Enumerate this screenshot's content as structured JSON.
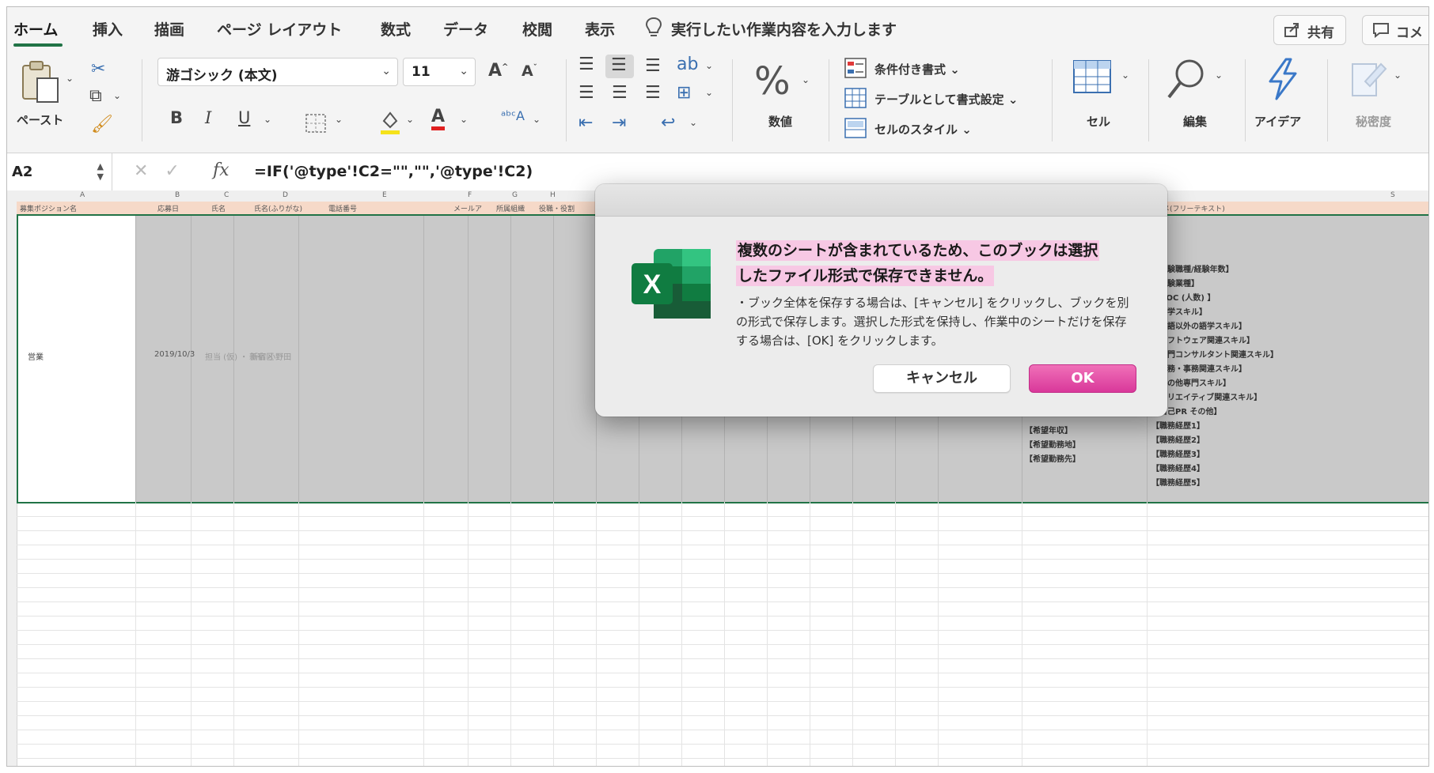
{
  "ribbon_tabs": [
    "ホーム",
    "挿入",
    "描画",
    "ページ レイアウト",
    "数式",
    "データ",
    "校閲",
    "表示"
  ],
  "tell_me": "実行したい作業内容を入力します",
  "share_label": "共有",
  "comment_label": "コメ",
  "clipboard": {
    "paste_label": "ペースト"
  },
  "font": {
    "name": "游ゴシック (本文)",
    "size": "11",
    "bold": "B",
    "italic": "I",
    "underline": "U",
    "grow": "A",
    "shrink": "A",
    "font_color": "A"
  },
  "number": {
    "symbol": "%",
    "label": "数値"
  },
  "styles": {
    "conditional": "条件付き書式",
    "as_table": "テーブルとして書式設定",
    "cell_styles": "セルのスタイル"
  },
  "cells_label": "セル",
  "editing_label": "編集",
  "ideas_label": "アイデア",
  "sensitivity_label": "秘密度",
  "name_box": "A2",
  "fx_label": "fx",
  "formula": "=IF('@type'!C2=\"\",\"\",'@type'!C2)",
  "sheet": {
    "columns": [
      "A",
      "B",
      "C",
      "D",
      "E",
      "F",
      "G",
      "H",
      "S"
    ],
    "row1_headers": [
      "募集ポジション名",
      "応募日",
      "氏名",
      "氏名(ふりがな)",
      "電話番号",
      "メールア",
      "所属組織",
      "役職・役割",
      "フェメ(フリーテキスト)"
    ],
    "cell_a2": "営業",
    "cell_b2": "2019/10/3",
    "blurred_c2": "担当 (仮) ・ 新宿区",
    "blurred_d2": "新宿 小野田",
    "col_s_list": [
      "【経験職種/経験年数】",
      "【経験業種】",
      "【OOC (人数) 】",
      "【語学スキル】",
      "【英語以外の語学スキル】",
      "【ソフトウェア関連スキル】",
      "【専門コンサルタント関連スキル】",
      "【法務・事務関連スキル】",
      "【その他専門スキル】",
      "【クリエイティブ関連スキル】",
      "【自己PR その他】",
      "【職務経歴1】",
      "【職務経歴2】",
      "【職務経歴3】",
      "【職務経歴4】",
      "【職務経歴5】"
    ],
    "col_r_list": [
      "【希望年収】",
      "【希望勤務地】",
      "【希望勤務先】"
    ]
  },
  "dialog": {
    "title_line1": "複数のシートが含まれているため、このブックは選択",
    "title_line2": "したファイル形式で保存できません。",
    "body": "・ブック全体を保存する場合は、[キャンセル] をクリックし、ブックを別の形式で保存します。選択した形式を保持し、作業中のシートだけを保存する場合は、[OK] をクリックします。",
    "cancel_label": "キャンセル",
    "ok_label": "OK",
    "logo_letter": "X"
  },
  "colors": {
    "excel_green": "#217346",
    "ok_pink": "#e0489f",
    "highlight_pink": "#f7c8e4",
    "header_row_fill": "#f6d9c8",
    "selected_row_fill": "#c9c9c9"
  }
}
